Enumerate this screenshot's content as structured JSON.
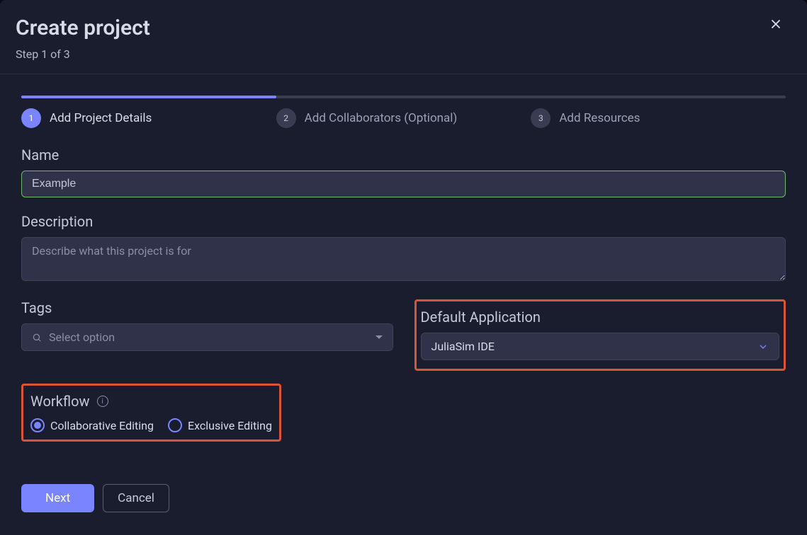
{
  "header": {
    "title": "Create project",
    "subtitle": "Step 1 of 3"
  },
  "steps": [
    {
      "number": "1",
      "label": "Add Project Details"
    },
    {
      "number": "2",
      "label": "Add Collaborators (Optional)"
    },
    {
      "number": "3",
      "label": "Add Resources"
    }
  ],
  "form": {
    "name": {
      "label": "Name",
      "value": "Example"
    },
    "description": {
      "label": "Description",
      "placeholder": "Describe what this project is for"
    },
    "tags": {
      "label": "Tags",
      "placeholder": "Select option"
    },
    "defaultApp": {
      "label": "Default Application",
      "value": "JuliaSim IDE"
    },
    "workflow": {
      "label": "Workflow",
      "options": [
        {
          "label": "Collaborative Editing",
          "checked": true
        },
        {
          "label": "Exclusive Editing",
          "checked": false
        }
      ]
    }
  },
  "buttons": {
    "next": "Next",
    "cancel": "Cancel"
  }
}
